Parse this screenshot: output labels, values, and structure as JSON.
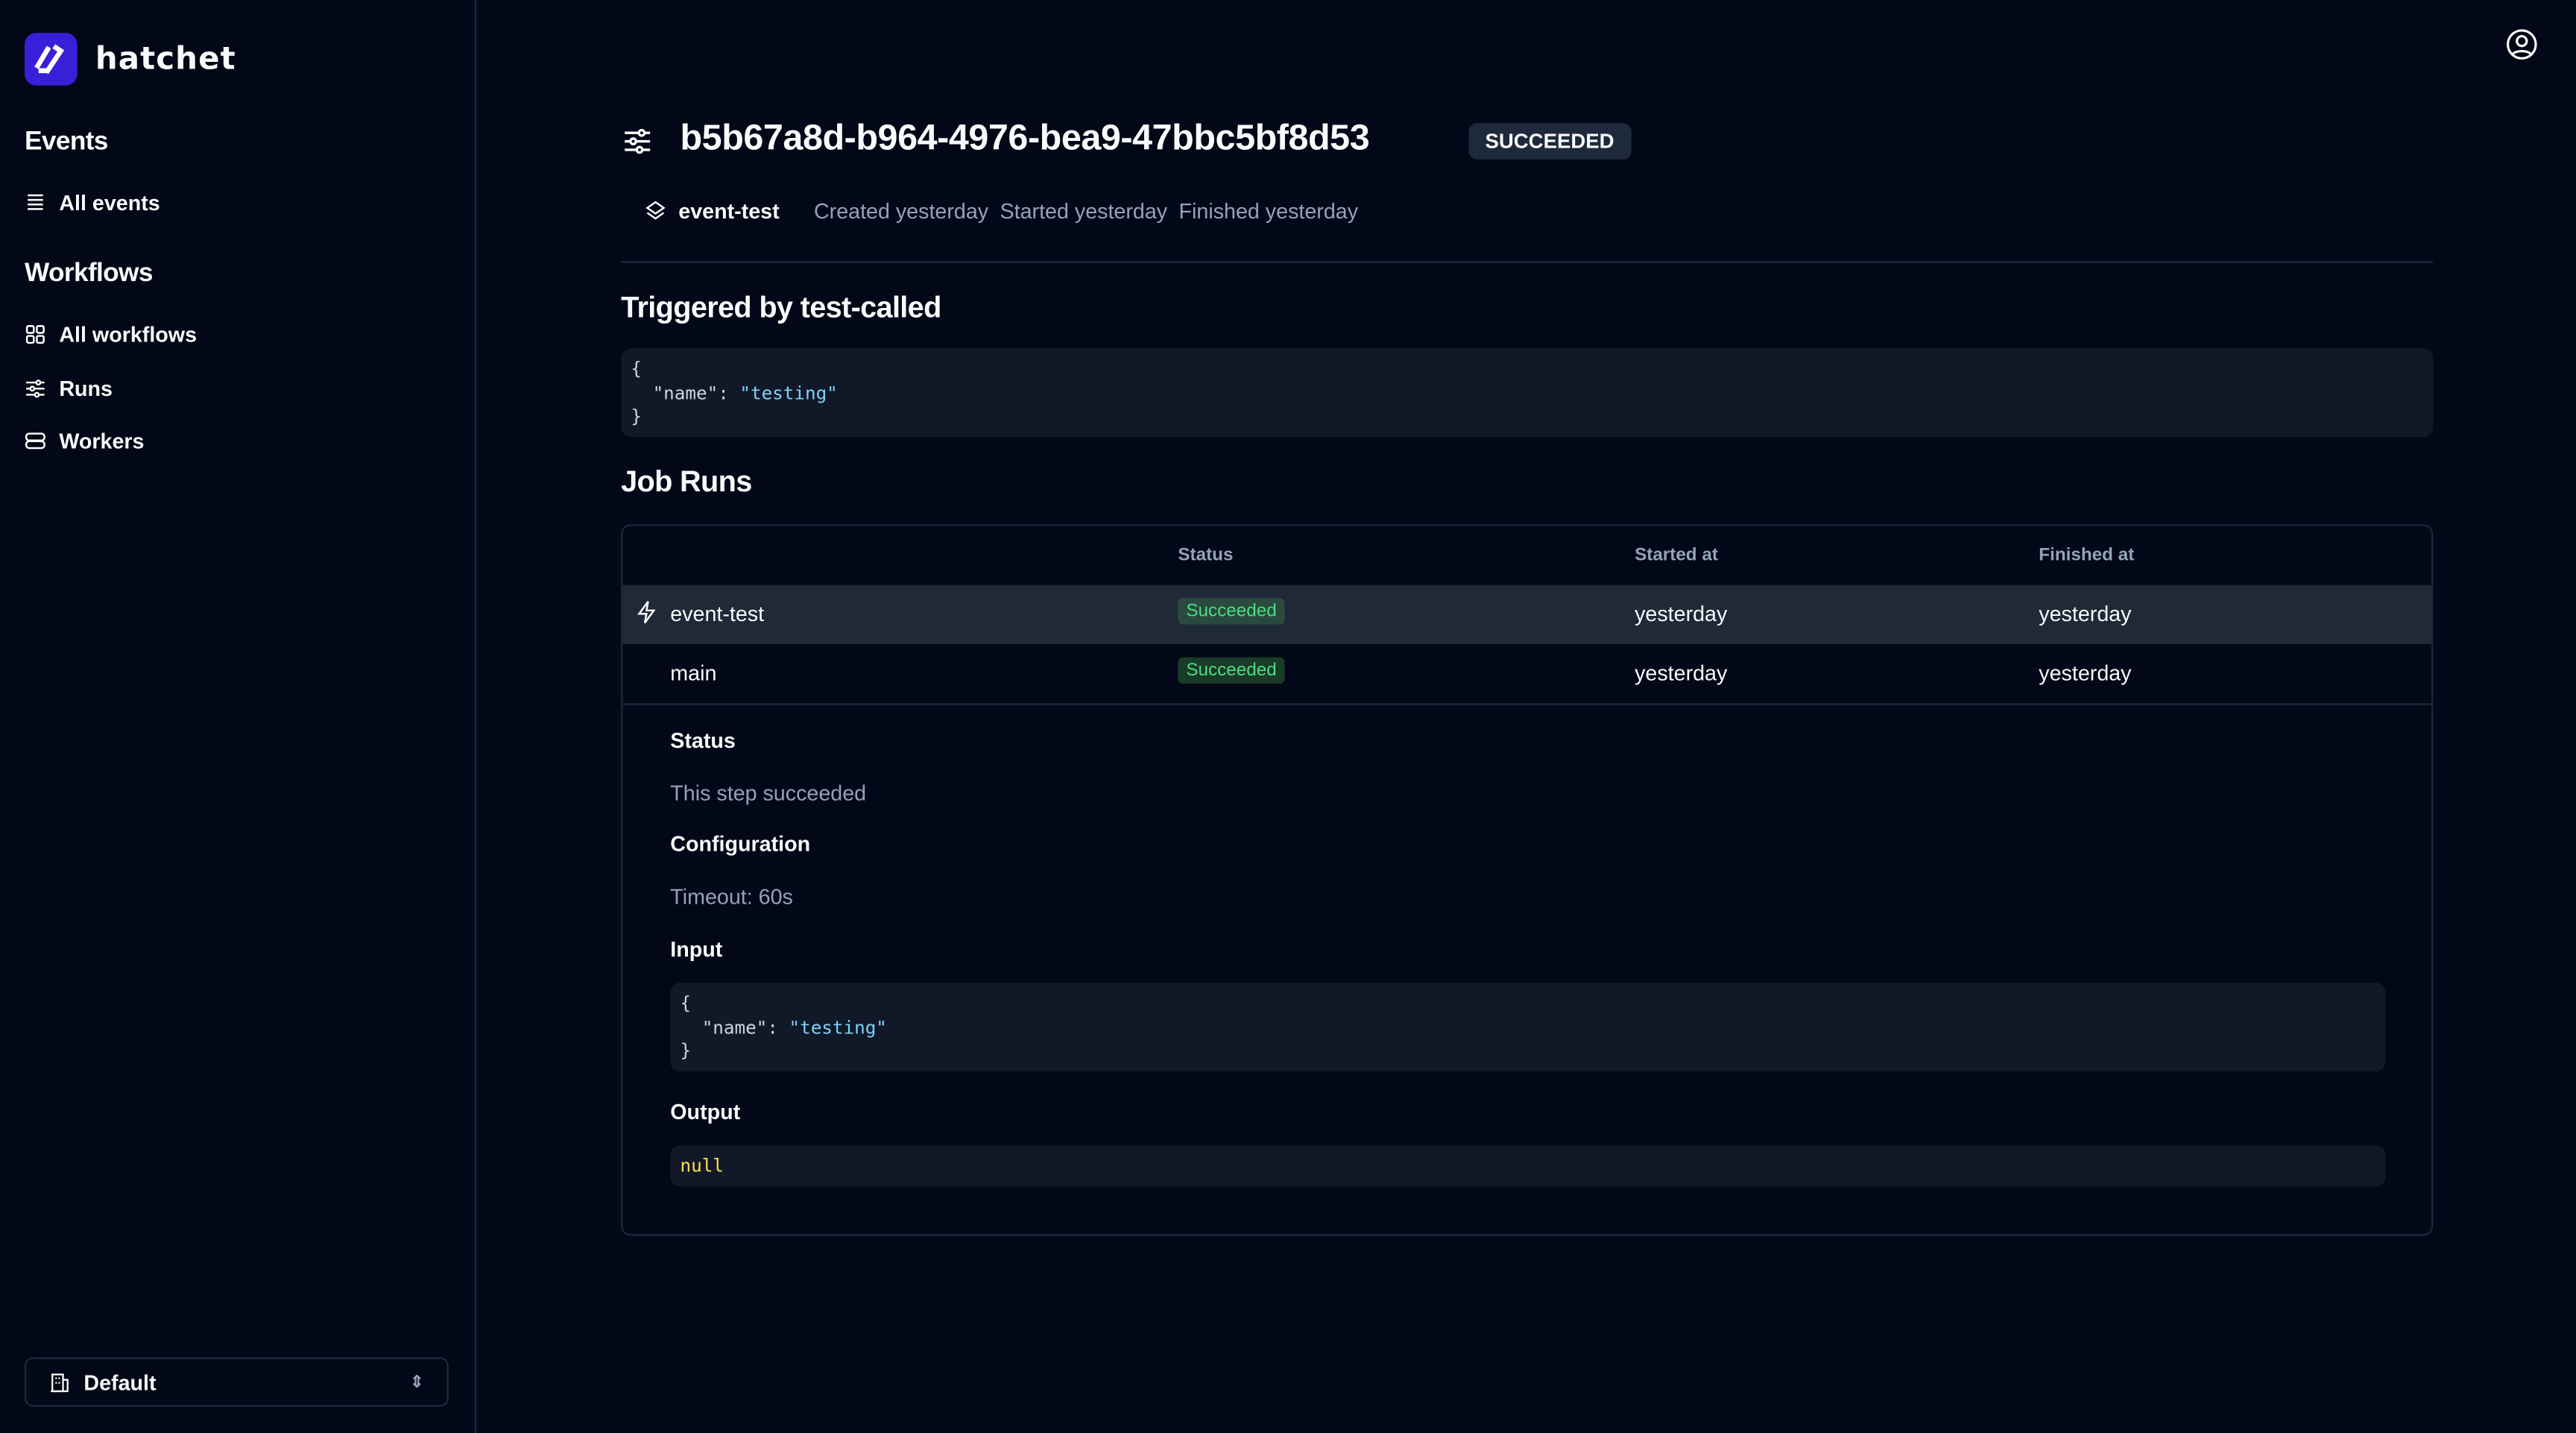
{
  "sidebar": {
    "brand": "hatchet",
    "sections": [
      {
        "title": "Events",
        "items": [
          {
            "label": "All events",
            "icon": "list-icon"
          }
        ]
      },
      {
        "title": "Workflows",
        "items": [
          {
            "label": "All workflows",
            "icon": "grid-icon"
          },
          {
            "label": "Runs",
            "icon": "sliders-icon"
          },
          {
            "label": "Workers",
            "icon": "server-icon"
          }
        ]
      }
    ],
    "tenant": "Default"
  },
  "header": {
    "run_id": "b5b67a8d-b964-4976-bea9-47bbc5bf8d53",
    "status": "SUCCEEDED",
    "workflow": "event-test",
    "created": "Created yesterday",
    "started": "Started yesterday",
    "finished": "Finished yesterday"
  },
  "trigger": {
    "title": "Triggered by test-called",
    "json_key": "\"name\"",
    "json_value": "\"testing\""
  },
  "job_runs": {
    "title": "Job Runs",
    "columns": [
      "",
      "Status",
      "Started at",
      "Finished at"
    ],
    "rows": [
      {
        "name": "event-test",
        "status": "Succeeded",
        "started": "yesterday",
        "finished": "yesterday"
      },
      {
        "name": "main",
        "status": "Succeeded",
        "started": "yesterday",
        "finished": "yesterday"
      }
    ],
    "details": {
      "status_label": "Status",
      "status_text": "This step succeeded",
      "config_label": "Configuration",
      "timeout": "Timeout: 60s",
      "input_label": "Input",
      "input_key": "\"name\"",
      "input_value": "\"testing\"",
      "output_label": "Output",
      "output_value": "null"
    }
  },
  "colors": {
    "background": "#020817",
    "brand": "#3a1fd8",
    "success": "#4ade80",
    "string": "#7dd3fc"
  }
}
